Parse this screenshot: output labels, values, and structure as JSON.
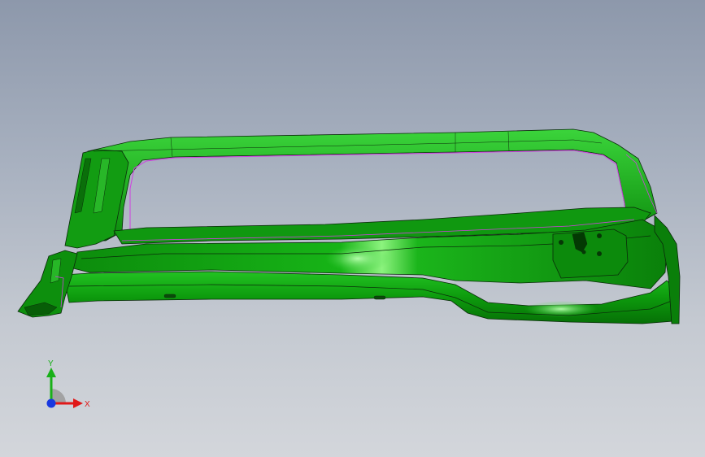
{
  "view": {
    "background_top": "#8d98ab",
    "background_bottom": "#d3d6db"
  },
  "model": {
    "part_color": "#0e9a0e",
    "part_highlight": "#5fe05a",
    "part_shadow": "#065a06",
    "edge_color": "#0a2a0a",
    "selection_edge_color": "#d040e0"
  },
  "triad": {
    "x_label": "X",
    "y_label": "Y",
    "x_color": "#e01818",
    "y_color": "#18b018",
    "z_color": "#1838e0"
  }
}
